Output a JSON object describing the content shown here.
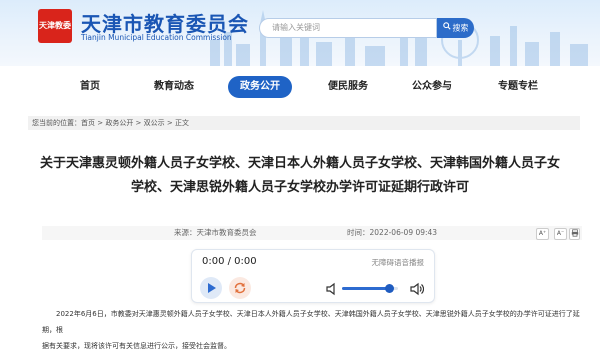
{
  "header": {
    "logo_text": "天津教委",
    "site_title": "天津市教育委员会",
    "site_subtitle": "Tianjin Municipal Education Commission",
    "search_placeholder": "请输入关键词",
    "search_button": "搜索"
  },
  "nav": {
    "items": [
      {
        "label": "首页"
      },
      {
        "label": "教育动态"
      },
      {
        "label": "政务公开",
        "active": true
      },
      {
        "label": "便民服务"
      },
      {
        "label": "公众参与"
      },
      {
        "label": "专题专栏"
      }
    ]
  },
  "breadcrumb": "您当前的位置：首页 > 政务公开 > 双公示 > 正文",
  "article": {
    "title": "关于天津惠灵顿外籍人员子女学校、天津日本人外籍人员子女学校、天津韩国外籍人员子女学校、天津思锐外籍人员子女学校办学许可证延期行政许可",
    "source": "来源：天津市教育委员会",
    "time": "时间：2022-06-09 09:43",
    "font_buttons": [
      "A⁺",
      "A⁻"
    ],
    "body_line1": "2022年6月6日，市教委对天津惠灵顿外籍人员子女学校、天津日本人外籍人员子女学校、天津韩国外籍人员子女学校、天津思锐外籍人员子女学校的办学许可证进行了延期，根",
    "body_line2": "据有关要求，现将该许可有关信息进行公示，接受社会监督。"
  },
  "player": {
    "time_display": "0:00 / 0:00",
    "label": "无障碍语音播报",
    "volume": 0.85,
    "colors": {
      "accent": "#2d6bd0",
      "play_bg": "#dfe9f7",
      "loop_bg": "#fbe9e1",
      "loop_icon": "#e2713d"
    }
  },
  "colors": {
    "brand_blue": "#1a56b4",
    "nav_active": "#1f63c6",
    "logo_red": "#d9241b"
  },
  "icons": [
    "search-icon",
    "play-icon",
    "loop-icon",
    "volume-low-icon",
    "volume-high-icon"
  ]
}
